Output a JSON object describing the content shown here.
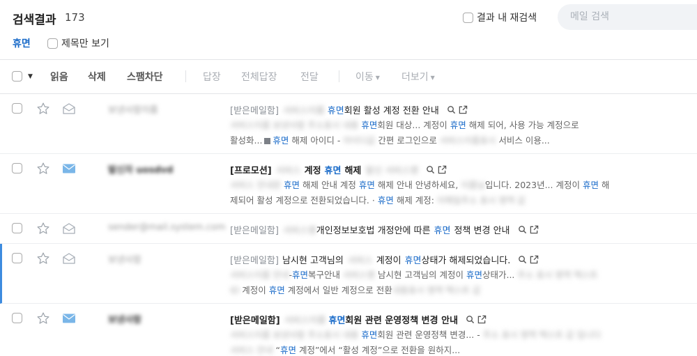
{
  "header": {
    "title": "검색결과",
    "count": "173",
    "in_result_label": "결과 내 재검색",
    "search_placeholder": "메일 검색",
    "filter_tag": "휴면",
    "subject_only_label": "제목만 보기"
  },
  "toolbar": {
    "read": "읽음",
    "delete": "삭제",
    "spam_block": "스팸차단",
    "reply": "답장",
    "reply_all": "전체답장",
    "forward": "전달",
    "move": "이동",
    "more": "더보기"
  },
  "keyword": "휴면",
  "mails": [
    {
      "sender": "보낸사람이름",
      "folder": "[받은메일함]",
      "subject_blur": "서비스이름",
      "subject_post": "회원 활성 계정 전환 안내",
      "preview1_blur": "서비스이름 보낸사람 주소표시 내용",
      "preview1_post": "회원 대상... 계정이",
      "preview1_kw2": "휴면",
      "preview1_tail": "해제 되어, 사용 가능 계정으로",
      "preview2_pre": "활성화...",
      "preview2_post": "해제 아이디 -",
      "preview2_blur": "아이디값",
      "preview2_mid": "간편 로그인으로",
      "preview2_blur2": "서비스이름표시",
      "preview2_tail": "서비스 이용..."
    },
    {
      "sender": "발신자 uosdvd",
      "folder": "[프로모션]",
      "subject_blur": "서비스",
      "subject_pre": "계정",
      "subject_post": "해제",
      "subject_blur2": "발신 서비스명",
      "preview1_blur": "서비스 안내문",
      "preview1_kw": "휴면",
      "preview1_mid": "해제 안내 계정",
      "preview1_kw2": "휴면",
      "preview1_mid2": "해제 안내 안녕하세요,",
      "preview1_blur2": "이름님",
      "preview1_tail": "입니다. 2023년... 계정이",
      "preview1_kw3": "휴면",
      "preview1_end": "해",
      "preview2_pre": "제되어 활성 계정으로 전환되었습니다. ·",
      "preview2_post": "해제 계정:",
      "preview2_blur": "이메일주소 표시 영역 값"
    },
    {
      "sender": "sender@mail.system.com",
      "folder": "[받은메일함]",
      "subject_blur": "서비스명",
      "subject_pre": "개인정보보호법 개정안에 따른",
      "subject_post": "정책 변경 안내"
    },
    {
      "sender": "보낸사람",
      "folder": "[받은메일함]",
      "subject_pre": "남시현 고객님의",
      "subject_blur": "서비스",
      "subject_mid": "계정이",
      "subject_post": "상태가 해제되었습니다.",
      "preview1_blur": "서비스이름 안내",
      "preview1_pre": "-",
      "preview1_post": "복구안내",
      "preview1_blur2": "서비스명",
      "preview1_mid": "남시현 고객님의 계정이",
      "preview1_tail": "상태가...",
      "preview1_blur3": "주소 표시 영역 텍스트",
      "preview2_blur": "ID",
      "preview2_pre": "계정이",
      "preview2_post": "계정에서 일반 계정으로 전환",
      "preview2_blur2": "내용표시 영역 텍스트 값"
    },
    {
      "sender": "보낸사람",
      "folder": "[받은메일함]",
      "subject_blur": "서비스이름",
      "subject_post": "회원 관련 운영정책 변경 안내",
      "preview1_blur": "서비스이름 보낸사람 주소표시 내용",
      "preview1_post": "회원 관련 운영정책 변경... -",
      "preview1_blur2": "주소 표시 영역 텍스트 값 입니다",
      "preview2_blur": "서비스 안내",
      "preview2_pre": "“",
      "preview2_post": "계정”에서 “활성 계정”으로 전환을 원하지..."
    }
  ],
  "colors": {
    "keyword": "#1a6bc9",
    "envelope_read": "#a7aeb7",
    "envelope_unread": "#7ab6e8",
    "active_bar": "#3d8bdf"
  }
}
